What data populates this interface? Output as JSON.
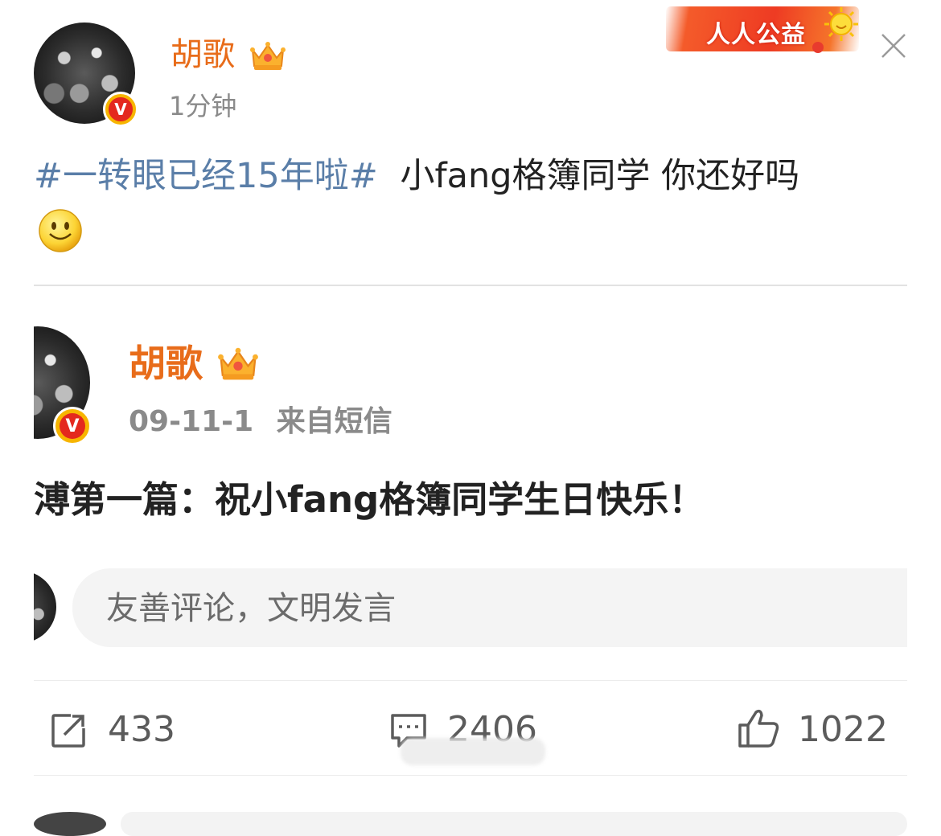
{
  "banner": {
    "text": "人人公益"
  },
  "post": {
    "author": "胡歌",
    "time": "1分钟",
    "hashtag": "#一转眼已经15年啦#",
    "text": "小fang格簿同学 你还好吗",
    "verified_badge": "V",
    "emoji_icon": "smile-emoji"
  },
  "repost": {
    "author": "胡歌",
    "date": "09-11-1",
    "source": "来自短信",
    "verified_badge": "V",
    "text": "溥第一篇：祝小fang格簿同学生日快乐！"
  },
  "comment_input": {
    "placeholder": "友善评论，文明发言"
  },
  "actions": {
    "repost_count": "433",
    "comment_count": "2406",
    "like_count": "1022"
  },
  "colors": {
    "username": "#e86c1a",
    "topic": "#5a7ea8",
    "meta": "#8a8a8a",
    "banner": "#ee3b23"
  }
}
